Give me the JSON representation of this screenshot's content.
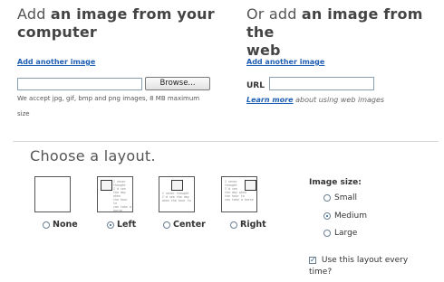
{
  "computer": {
    "title_prefix": "Add ",
    "title_bold": "an image from your",
    "title_line2": "computer",
    "add_another": "Add another image",
    "browse_label": "Browse...",
    "accept_line1": "We accept jpg, gif, bmp and png images, 8 MB maximum",
    "accept_line2": "size"
  },
  "web": {
    "title_prefix": "Or add ",
    "title_bold": "an image from the",
    "title_line2": "web",
    "add_another": "Add another image",
    "url_label": "URL",
    "url_value": "",
    "learn_more": "Learn more",
    "learn_rest": " about using web images"
  },
  "layout": {
    "title": "Choose a layout.",
    "thumb_text": "I never\nthought\nI'd see\nthe day when\nthe hour to\ncan take a horse",
    "options": [
      {
        "label": "None",
        "selected": false
      },
      {
        "label": "Left",
        "selected": true
      },
      {
        "label": "Center",
        "selected": false
      },
      {
        "label": "Right",
        "selected": false
      }
    ]
  },
  "image_size": {
    "title": "Image size:",
    "options": [
      {
        "label": "Small",
        "selected": false
      },
      {
        "label": "Medium",
        "selected": true
      },
      {
        "label": "Large",
        "selected": false
      }
    ],
    "remember_line1": "Use this layout every",
    "remember_line2": "time?",
    "remember_checked": true
  }
}
